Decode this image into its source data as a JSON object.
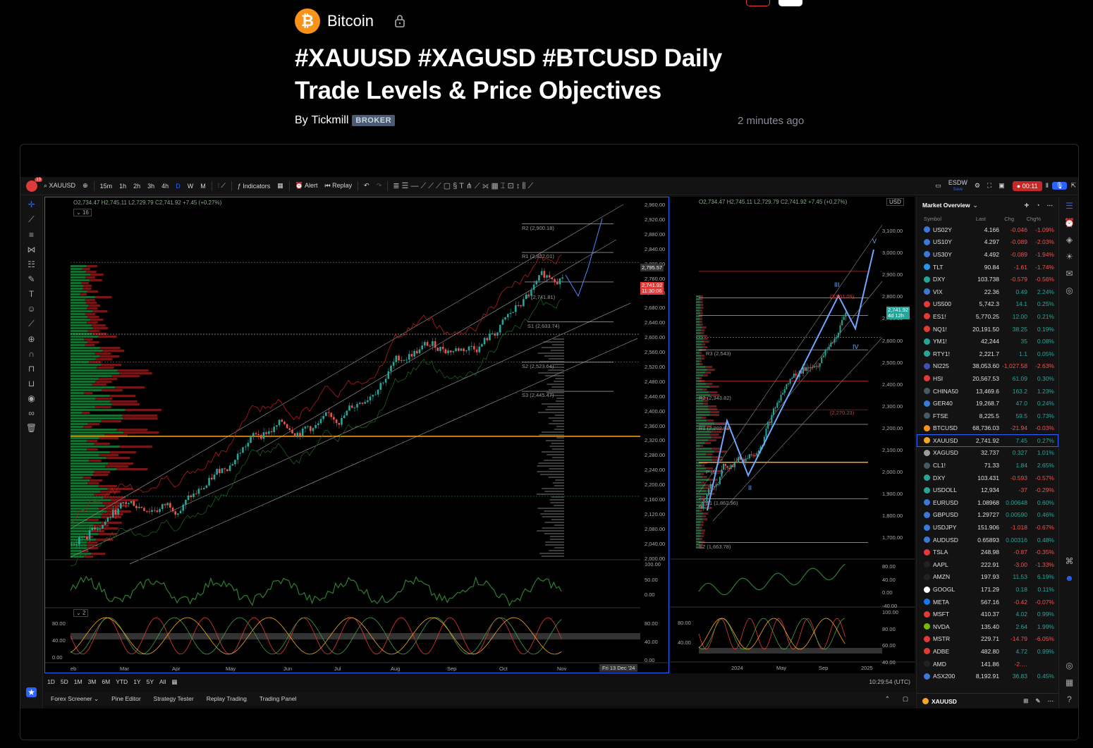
{
  "article": {
    "category": "Bitcoin",
    "category_icon": "bitcoin-icon",
    "title": "#XAUUSD #XAGUSD #BTCUSD Daily Trade Levels & Price Objectives",
    "byline_prefix": "By",
    "author": "Tickmill",
    "author_badge": "BROKER",
    "time_ago": "2 minutes ago"
  },
  "toolbar": {
    "symbol": "XAUUSD",
    "notification_count": "13",
    "intervals": [
      "15m",
      "1h",
      "2h",
      "3h",
      "4h",
      "D",
      "W",
      "M"
    ],
    "active_interval": "D",
    "indicators_label": "Indicators",
    "alert_label": "Alert",
    "replay_label": "Replay",
    "layout_name": "ESDW",
    "layout_sub": "Save",
    "record_time": "00:11"
  },
  "chart1": {
    "ohlc": "O2,734.47  H2,745.11  L2,729.79  C2,741.92 +7.45 (+0.27%)",
    "indicator_count": "16",
    "price_ticks": [
      "2,960.00",
      "2,920.00",
      "2,880.00",
      "2,840.00",
      "2,800.00",
      "2,760.00",
      "2,720.00",
      "2,680.00",
      "2,640.00",
      "2,600.00",
      "2,560.00",
      "2,520.00",
      "2,480.00",
      "2,440.00",
      "2,400.00",
      "2,360.00",
      "2,320.00",
      "2,280.00",
      "2,240.00",
      "2,200.00",
      "2,160.00",
      "2,120.00",
      "2,080.00",
      "2,040.00",
      "2,000.00"
    ],
    "current_price": "2,741.92",
    "countdown": "11:30:06",
    "cursor_price": "2,795.57",
    "levels": [
      "R2 (2,900.18)",
      "R1 (2,822.01)",
      "P (2,741.81)",
      "S1 (2,633.74)",
      "S2 (2,523.64)",
      "S3 (2,445.47)"
    ],
    "months": [
      "eb",
      "Mar",
      "Apr",
      "May",
      "Jun",
      "Jul",
      "Aug",
      "Sep",
      "Oct",
      "Nov"
    ],
    "date_badge": "Fri 13 Dec '24",
    "rsi_ticks": [
      "100.00",
      "50.00",
      "0.00"
    ],
    "stoch_count": "2",
    "stoch_ticks": [
      "80.00",
      "40.00",
      "0.00"
    ]
  },
  "chart2": {
    "ohlc": "O2,734.47  H2,745.11  L2,729.79  C2,741.92 +7.45 (+0.27%)",
    "currency": "USD",
    "price_ticks": [
      "3,100.00",
      "3,000.00",
      "2,900.00",
      "2,800.00",
      "2,700.00",
      "2,600.00",
      "2,500.00",
      "2,400.00",
      "2,300.00",
      "2,200.00",
      "2,100.00",
      "2,000.00",
      "1,900.00",
      "1,800.00",
      "1,700.00"
    ],
    "current_price": "2,741.92",
    "countdown": "4d 12h",
    "levels": [
      "R3 (2,543)",
      "R2 (2,343.82)",
      "R1 (2,202.98)",
      "P (1,...)",
      "S1 (1,862.96)",
      "S2 (1,663.78)",
      "(2,901.09)",
      "(2,270.23)"
    ],
    "waves": [
      "III",
      "IV",
      "V",
      "II"
    ],
    "months": [
      "2024",
      "May",
      "Sep",
      "2025"
    ],
    "rsi_ticks": [
      "80.00",
      "40.00",
      "0.00",
      "-40.00"
    ],
    "stoch_ticks": [
      "100.00",
      "80.00",
      "60.00",
      "40.00"
    ],
    "stoch_left_ticks": [
      "80.00",
      "40.00"
    ]
  },
  "bottom": {
    "ranges": [
      "1D",
      "5D",
      "1M",
      "3M",
      "6M",
      "YTD",
      "1Y",
      "5Y",
      "All"
    ],
    "clock": "10:29:54 (UTC)",
    "panels": [
      "Forex Screener",
      "Pine Editor",
      "Strategy Tester",
      "Replay Trading",
      "Trading Panel"
    ]
  },
  "watchlist": {
    "title": "Market Overview",
    "headers": [
      "Symbol",
      "Last",
      "Chg",
      "Chg%"
    ],
    "rows": [
      {
        "sym": "US02Y",
        "last": "4.166",
        "chg": "-0.046",
        "pct": "-1.09%",
        "dir": "dn",
        "icon": "#3c78d8"
      },
      {
        "sym": "US10Y",
        "last": "4.297",
        "chg": "-0.089",
        "pct": "-2.03%",
        "dir": "dn",
        "icon": "#3c78d8"
      },
      {
        "sym": "US30Y",
        "last": "4.492",
        "chg": "-0.089",
        "pct": "-1.94%",
        "dir": "dn",
        "icon": "#3c78d8"
      },
      {
        "sym": "TLT",
        "last": "90.84",
        "chg": "-1.61",
        "pct": "-1.74%",
        "dir": "dn",
        "icon": "#2196f3"
      },
      {
        "sym": "DXY",
        "last": "103.738",
        "chg": "-0.579",
        "pct": "-0.56%",
        "dir": "dn",
        "icon": "#26a69a"
      },
      {
        "sym": "VIX",
        "last": "22.36",
        "chg": "0.49",
        "pct": "2.24%",
        "dir": "up",
        "icon": "#3c78d8"
      },
      {
        "sym": "US500",
        "last": "5,742.3",
        "chg": "14.1",
        "pct": "0.25%",
        "dir": "up",
        "icon": "#e53935"
      },
      {
        "sym": "ES1!",
        "last": "5,770.25",
        "chg": "12.00",
        "pct": "0.21%",
        "dir": "up",
        "icon": "#e53935"
      },
      {
        "sym": "NQ1!",
        "last": "20,191.50",
        "chg": "38.25",
        "pct": "0.19%",
        "dir": "up",
        "icon": "#e53935"
      },
      {
        "sym": "YM1!",
        "last": "42,244",
        "chg": "35",
        "pct": "0.08%",
        "dir": "up",
        "icon": "#26a69a"
      },
      {
        "sym": "RTY1!",
        "last": "2,221.7",
        "chg": "1.1",
        "pct": "0.05%",
        "dir": "up",
        "icon": "#26a69a"
      },
      {
        "sym": "NI225",
        "last": "38,053.60",
        "chg": "-1,027.58",
        "pct": "-2.63%",
        "dir": "dn",
        "icon": "#3f51b5"
      },
      {
        "sym": "HSI",
        "last": "20,567.53",
        "chg": "61.09",
        "pct": "0.30%",
        "dir": "up",
        "icon": "#e53935"
      },
      {
        "sym": "CHINA50",
        "last": "13,469.6",
        "chg": "163.2",
        "pct": "1.23%",
        "dir": "up",
        "icon": "#455a64"
      },
      {
        "sym": "GER40",
        "last": "19,268.7",
        "chg": "47.0",
        "pct": "0.24%",
        "dir": "up",
        "icon": "#3c78d8"
      },
      {
        "sym": "FTSE",
        "last": "8,225.5",
        "chg": "59.5",
        "pct": "0.73%",
        "dir": "up",
        "icon": "#455a64"
      },
      {
        "sym": "BTCUSD",
        "last": "68,736.03",
        "chg": "-21.94",
        "pct": "-0.03%",
        "dir": "dn",
        "icon": "#f7931a"
      },
      {
        "sym": "XAUUSD",
        "last": "2,741.92",
        "chg": "7.45",
        "pct": "0.27%",
        "dir": "up",
        "icon": "#f5a623"
      },
      {
        "sym": "XAGUSD",
        "last": "32.737",
        "chg": "0.327",
        "pct": "1.01%",
        "dir": "up",
        "icon": "#9e9e9e"
      },
      {
        "sym": "CL1!",
        "last": "71.33",
        "chg": "1.84",
        "pct": "2.65%",
        "dir": "up",
        "icon": "#455a64"
      },
      {
        "sym": "DXY",
        "last": "103.431",
        "chg": "-0.593",
        "pct": "-0.57%",
        "dir": "dn",
        "icon": "#26a69a"
      },
      {
        "sym": "USDOLL",
        "last": "12,934",
        "chg": "-37",
        "pct": "-0.29%",
        "dir": "dn",
        "icon": "#26a69a"
      },
      {
        "sym": "EURUSD",
        "last": "1.08968",
        "chg": "0.00648",
        "pct": "0.60%",
        "dir": "up",
        "icon": "#3c78d8"
      },
      {
        "sym": "GBPUSD",
        "last": "1.29727",
        "chg": "0.00590",
        "pct": "0.46%",
        "dir": "up",
        "icon": "#3c78d8"
      },
      {
        "sym": "USDJPY",
        "last": "151.906",
        "chg": "-1.018",
        "pct": "-0.67%",
        "dir": "dn",
        "icon": "#3c78d8"
      },
      {
        "sym": "AUDUSD",
        "last": "0.65893",
        "chg": "0.00316",
        "pct": "0.48%",
        "dir": "up",
        "icon": "#3c78d8"
      },
      {
        "sym": "TSLA",
        "last": "248.98",
        "chg": "-0.87",
        "pct": "-0.35%",
        "dir": "dn",
        "icon": "#e53935"
      },
      {
        "sym": "AAPL",
        "last": "222.91",
        "chg": "-3.00",
        "pct": "-1.33%",
        "dir": "dn",
        "icon": "#222"
      },
      {
        "sym": "AMZN",
        "last": "197.93",
        "chg": "11.53",
        "pct": "6.19%",
        "dir": "up",
        "icon": "#222"
      },
      {
        "sym": "GOOGL",
        "last": "171.29",
        "chg": "0.18",
        "pct": "0.11%",
        "dir": "up",
        "icon": "#fff"
      },
      {
        "sym": "META",
        "last": "567.16",
        "chg": "-0.42",
        "pct": "-0.07%",
        "dir": "dn",
        "icon": "#1877f2"
      },
      {
        "sym": "MSFT",
        "last": "410.37",
        "chg": "4.02",
        "pct": "0.99%",
        "dir": "up",
        "icon": "#e53935"
      },
      {
        "sym": "NVDA",
        "last": "135.40",
        "chg": "2.64",
        "pct": "1.99%",
        "dir": "up",
        "icon": "#76b900"
      },
      {
        "sym": "MSTR",
        "last": "229.71",
        "chg": "-14.79",
        "pct": "-6.05%",
        "dir": "dn",
        "icon": "#e53935"
      },
      {
        "sym": "ADBE",
        "last": "482.80",
        "chg": "4.72",
        "pct": "0.99%",
        "dir": "up",
        "icon": "#e53935"
      },
      {
        "sym": "AMD",
        "last": "141.86",
        "chg": "-2.…",
        "pct": "",
        "dir": "dn",
        "icon": "#222"
      },
      {
        "sym": "ASX200",
        "last": "8,192.91",
        "chg": "36.83",
        "pct": "0.45%",
        "dir": "up",
        "icon": "#3c78d8"
      }
    ],
    "footer_symbol": "XAUUSD"
  },
  "colors": {
    "accent": "#2962ff",
    "up": "#26a69a",
    "down": "#ef5350",
    "bitcoin": "#f7931a"
  }
}
